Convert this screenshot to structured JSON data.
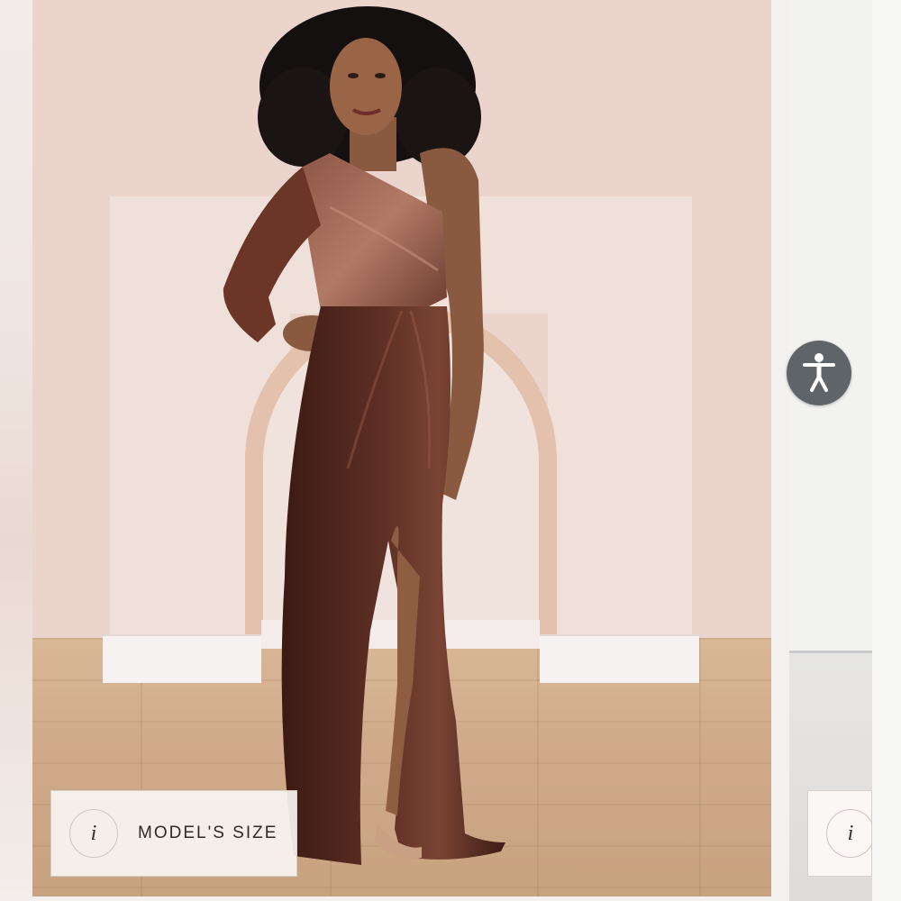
{
  "product_image": {
    "alt": "Model wearing one-shoulder long-sleeve velvet gown with thigh slit in chocolate brown"
  },
  "info_badge": {
    "icon": "info-icon",
    "icon_glyph": "i",
    "label": "MODEL'S SIZE"
  },
  "next_slide_badge": {
    "icon": "info-icon",
    "icon_glyph": "i"
  },
  "accessibility": {
    "icon": "accessibility-icon"
  },
  "colors": {
    "dress": "#4a241c",
    "wall": "#ead4cb",
    "floor": "#cfa98a",
    "accessibility_button": "#5f6468"
  }
}
